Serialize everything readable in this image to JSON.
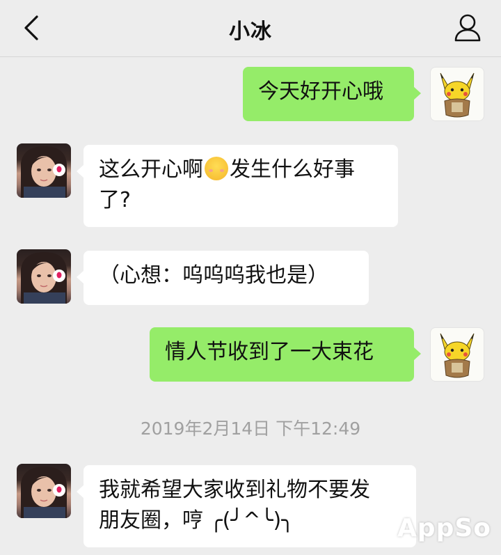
{
  "header": {
    "title": "小冰",
    "back_icon": "chevron-left-icon",
    "profile_icon": "person-icon"
  },
  "messages": [
    {
      "side": "out",
      "text": "今天好开心哦"
    },
    {
      "side": "in",
      "text_before": "这么开心啊",
      "emoji": "smiling-face-emoji",
      "text_after": "发生什么好事",
      "line2": "了?"
    },
    {
      "side": "in",
      "text": "（心想：呜呜呜我也是）"
    },
    {
      "side": "out",
      "text": "情人节收到了一大束花"
    },
    {
      "side": "in",
      "line1": "我就希望大家收到礼物不要发",
      "line2": "朋友圈，哼 ╭(╯^╰)╮"
    }
  ],
  "timestamp": "2019年2月14日 下午12:49",
  "watermark": "AppSo",
  "colors": {
    "background": "#ededed",
    "outgoing_bubble": "#95ec69",
    "incoming_bubble": "#ffffff",
    "timestamp": "#a0a0a0"
  }
}
